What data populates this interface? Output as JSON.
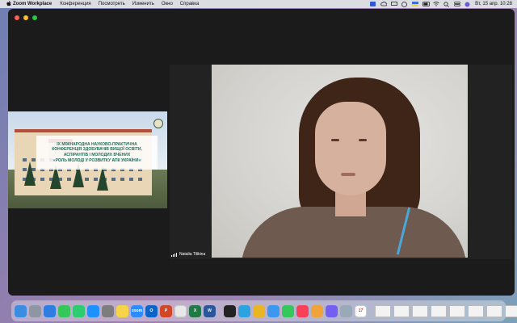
{
  "menubar": {
    "apple_icon": "apple-icon",
    "app_name": "Zoom Workplace",
    "menus": [
      "Конференция",
      "Посмотреть",
      "Изменить",
      "Окно",
      "Справка"
    ],
    "clock": "Вт, 15 апр.  10:28"
  },
  "share": {
    "slide_lines": [
      "IX МІЖНАРОДНА НАУКОВО-ПРАКТИЧНА",
      "КОНФЕРЕНЦІЯ ЗДОБУВАЧІВ ВИЩОЇ ОСВІТИ,",
      "АСПІРАНТІВ І МОЛОДИХ ВЧЕНИХ",
      "«РОЛЬ МОЛОДІ У РОЗВИТКУ АПК УКРАЇНИ»"
    ]
  },
  "video": {
    "participant_name": "Natalia Tilikina"
  },
  "dock": {
    "apps": [
      {
        "name": "Finder",
        "icon": "finder-icon",
        "color": "#3b8de2",
        "glyph": ""
      },
      {
        "name": "Launchpad",
        "icon": "launchpad-icon",
        "color": "#8f96a3",
        "glyph": ""
      },
      {
        "name": "Safari",
        "icon": "safari-icon",
        "color": "#2f7de1",
        "glyph": ""
      },
      {
        "name": "Messages",
        "icon": "messages-icon",
        "color": "#35c759",
        "glyph": ""
      },
      {
        "name": "FaceTime",
        "icon": "facetime-icon",
        "color": "#2ecc71",
        "glyph": ""
      },
      {
        "name": "App Store",
        "icon": "app-store-icon",
        "color": "#1e90ff",
        "glyph": ""
      },
      {
        "name": "System Settings",
        "icon": "settings-icon",
        "color": "#7d7d7d",
        "glyph": ""
      },
      {
        "name": "Notes",
        "icon": "notes-icon",
        "color": "#f5d547",
        "glyph": ""
      },
      {
        "name": "Zoom",
        "icon": "zoom-icon",
        "color": "#2d8cff",
        "glyph": "zoom"
      },
      {
        "name": "Outlook",
        "icon": "outlook-icon",
        "color": "#0a64c9",
        "glyph": "O"
      },
      {
        "name": "PowerPoint",
        "icon": "powerpoint-icon",
        "color": "#d24726",
        "glyph": "P"
      },
      {
        "name": "Word Online",
        "icon": "office-icon",
        "color": "#e8e8e8",
        "glyph": ""
      },
      {
        "name": "Excel",
        "icon": "excel-icon",
        "color": "#1f7a45",
        "glyph": "X"
      },
      {
        "name": "Word",
        "icon": "word-icon",
        "color": "#2b579a",
        "glyph": "W"
      },
      {
        "name": "Terminal",
        "icon": "terminal-icon",
        "color": "#222222",
        "glyph": ""
      },
      {
        "name": "Telegram",
        "icon": "telegram-icon",
        "color": "#2aa3df",
        "glyph": ""
      },
      {
        "name": "Chrome",
        "icon": "chrome-icon",
        "color": "#e9b525",
        "glyph": ""
      },
      {
        "name": "Mail",
        "icon": "mail-icon",
        "color": "#3b97f0",
        "glyph": ""
      },
      {
        "name": "Messages 2",
        "icon": "chat-icon",
        "color": "#34c759",
        "glyph": ""
      },
      {
        "name": "Music",
        "icon": "music-icon",
        "color": "#fa4059",
        "glyph": ""
      },
      {
        "name": "Photos",
        "icon": "photos-icon",
        "color": "#f1a33b",
        "glyph": ""
      },
      {
        "name": "Viber",
        "icon": "viber-icon",
        "color": "#7360f2",
        "glyph": ""
      },
      {
        "name": "Preview",
        "icon": "preview-icon",
        "color": "#9aa9b8",
        "glyph": ""
      },
      {
        "name": "Calendar",
        "icon": "calendar-icon",
        "color": "#ffffff",
        "glyph": "17"
      }
    ]
  }
}
